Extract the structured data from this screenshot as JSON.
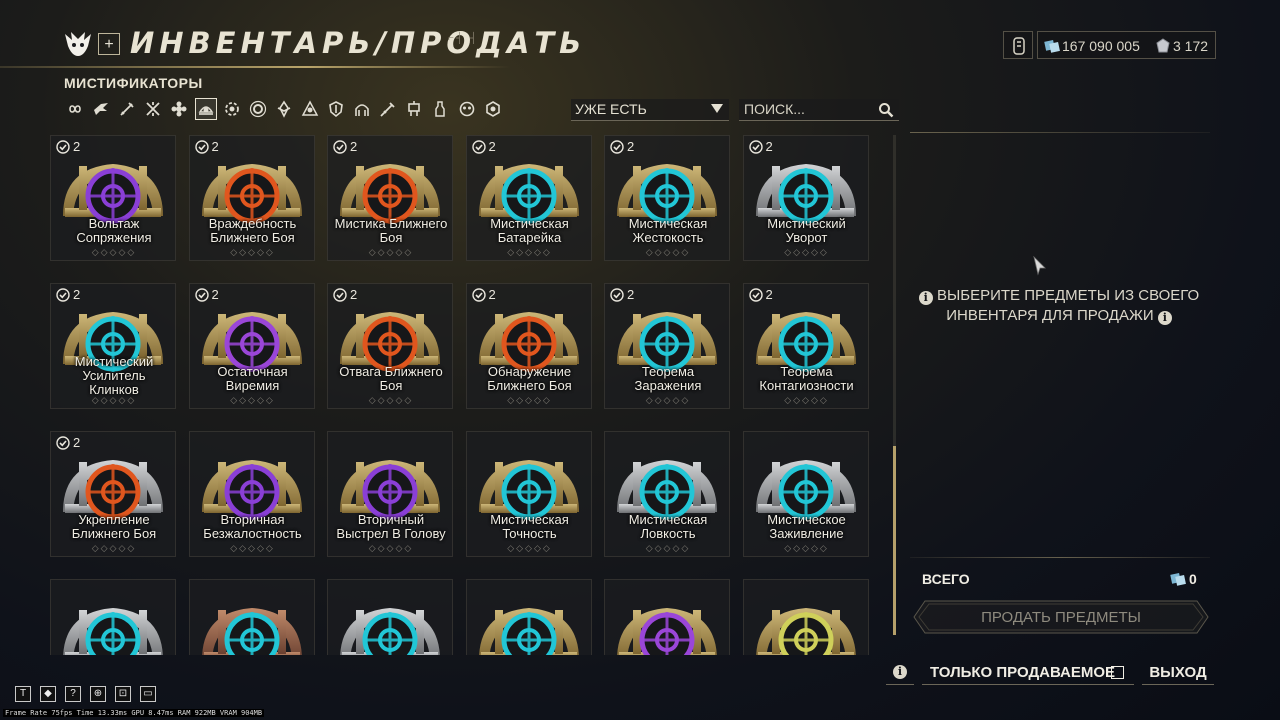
{
  "header": {
    "title": "ИНВЕНТАРЬ/ПРОДАТЬ",
    "plus_label": "+",
    "decor": "⌐┤ ┤"
  },
  "currency": {
    "credits": "167 090 005",
    "platinum": "3 172"
  },
  "category_title": "МИСТИФИКАТОРЫ",
  "filters": [
    {
      "icon": "infinity-icon"
    },
    {
      "icon": "bird-icon"
    },
    {
      "icon": "sword-icon"
    },
    {
      "icon": "crossed-swords-icon"
    },
    {
      "icon": "flower-icon"
    },
    {
      "icon": "arcane-icon",
      "selected": true
    },
    {
      "icon": "gear-flower-icon"
    },
    {
      "icon": "sun-icon"
    },
    {
      "icon": "lotus-icon"
    },
    {
      "icon": "triangle-circle-icon"
    },
    {
      "icon": "shield-icon"
    },
    {
      "icon": "arch-icon"
    },
    {
      "icon": "syringe-icon"
    },
    {
      "icon": "robot-icon"
    },
    {
      "icon": "bottle-icon"
    },
    {
      "icon": "mask-icon"
    },
    {
      "icon": "hex-icon"
    }
  ],
  "dropdown": {
    "label": "УЖЕ ЕСТЬ"
  },
  "search": {
    "placeholder": "ПОИСК..."
  },
  "items": [
    {
      "count": "2",
      "name_lines": [
        "Вольтаж",
        "Сопряжения"
      ],
      "color": "#8a3fd6",
      "frame": "gold"
    },
    {
      "count": "2",
      "name_lines": [
        "Враждебность",
        "Ближнего Боя"
      ],
      "color": "#e0561e",
      "frame": "gold"
    },
    {
      "count": "2",
      "name_lines": [
        "Мистика Ближнего",
        "Боя"
      ],
      "color": "#e0561e",
      "frame": "gold"
    },
    {
      "count": "2",
      "name_lines": [
        "Мистическая",
        "Батарейка"
      ],
      "color": "#22c6d6",
      "frame": "gold"
    },
    {
      "count": "2",
      "name_lines": [
        "Мистическая",
        "Жестокость"
      ],
      "color": "#22c6d6",
      "frame": "gold"
    },
    {
      "count": "2",
      "name_lines": [
        "Мистический",
        "Уворот"
      ],
      "color": "#22c6d6",
      "frame": "silver"
    },
    {
      "count": "2",
      "name_lines": [
        "Мистический",
        "Усилитель",
        "Клинков"
      ],
      "color": "#22c6d6",
      "frame": "gold"
    },
    {
      "count": "2",
      "name_lines": [
        "Остаточная",
        "Виремия"
      ],
      "color": "#9a46d8",
      "frame": "gold"
    },
    {
      "count": "2",
      "name_lines": [
        "Отвага Ближнего",
        "Боя"
      ],
      "color": "#e0561e",
      "frame": "gold"
    },
    {
      "count": "2",
      "name_lines": [
        "Обнаружение",
        "Ближнего Боя"
      ],
      "color": "#e0561e",
      "frame": "gold"
    },
    {
      "count": "2",
      "name_lines": [
        "Теорема",
        "Заражения"
      ],
      "color": "#22c6d6",
      "frame": "gold"
    },
    {
      "count": "2",
      "name_lines": [
        "Теорема",
        "Контагиозности"
      ],
      "color": "#22c6d6",
      "frame": "gold"
    },
    {
      "count": "2",
      "name_lines": [
        "Укрепление",
        "Ближнего Боя"
      ],
      "color": "#e0561e",
      "frame": "silver"
    },
    {
      "count": "",
      "name_lines": [
        "Вторичная",
        "Безжалостность"
      ],
      "color": "#8a3fd6",
      "frame": "gold"
    },
    {
      "count": "",
      "name_lines": [
        "Вторичный",
        "Выстрел В Голову"
      ],
      "color": "#8a3fd6",
      "frame": "gold"
    },
    {
      "count": "",
      "name_lines": [
        "Мистическая",
        "Точность"
      ],
      "color": "#22c6d6",
      "frame": "gold"
    },
    {
      "count": "",
      "name_lines": [
        "Мистическая",
        "Ловкость"
      ],
      "color": "#22c6d6",
      "frame": "silver"
    },
    {
      "count": "",
      "name_lines": [
        "Мистическое",
        "Заживление"
      ],
      "color": "#22c6d6",
      "frame": "silver"
    },
    {
      "count": "",
      "name_lines": [],
      "color": "#22c6d6",
      "frame": "silver"
    },
    {
      "count": "",
      "name_lines": [],
      "color": "#22c6d6",
      "frame": "copper"
    },
    {
      "count": "",
      "name_lines": [],
      "color": "#22c6d6",
      "frame": "silver"
    },
    {
      "count": "",
      "name_lines": [],
      "color": "#22c6d6",
      "frame": "gold"
    },
    {
      "count": "",
      "name_lines": [],
      "color": "#9a46d8",
      "frame": "gold"
    },
    {
      "count": "",
      "name_lines": [],
      "color": "#cfd05a",
      "frame": "gold"
    }
  ],
  "rank_dots": "◇◇◇◇◇",
  "panel": {
    "message_line1": "ВЫБЕРИТЕ ПРЕДМЕТЫ ИЗ СВОЕГО",
    "message_line2": "ИНВЕНТАРЯ ДЛЯ ПРОДАЖИ",
    "info_glyph": "i",
    "total_label": "ВСЕГО",
    "total_value": "0",
    "sell_button": "ПРОДАТЬ ПРЕДМЕТЫ"
  },
  "footer": {
    "sellable_only": "ТОЛЬКО ПРОДАВАЕМОЕ",
    "exit": "ВЫХОД",
    "info_glyph": "i"
  },
  "debug": {
    "buttons": [
      "T",
      "◆",
      "?",
      "⊕",
      "⊡",
      "▭"
    ],
    "stats": "Frame Rate 75fps Time 13.33ms GPU 8.47ms RAM 922MB VRAM 904MB"
  },
  "colors": {
    "gold": "#b59a5c",
    "accent": "#e8e3d2"
  }
}
